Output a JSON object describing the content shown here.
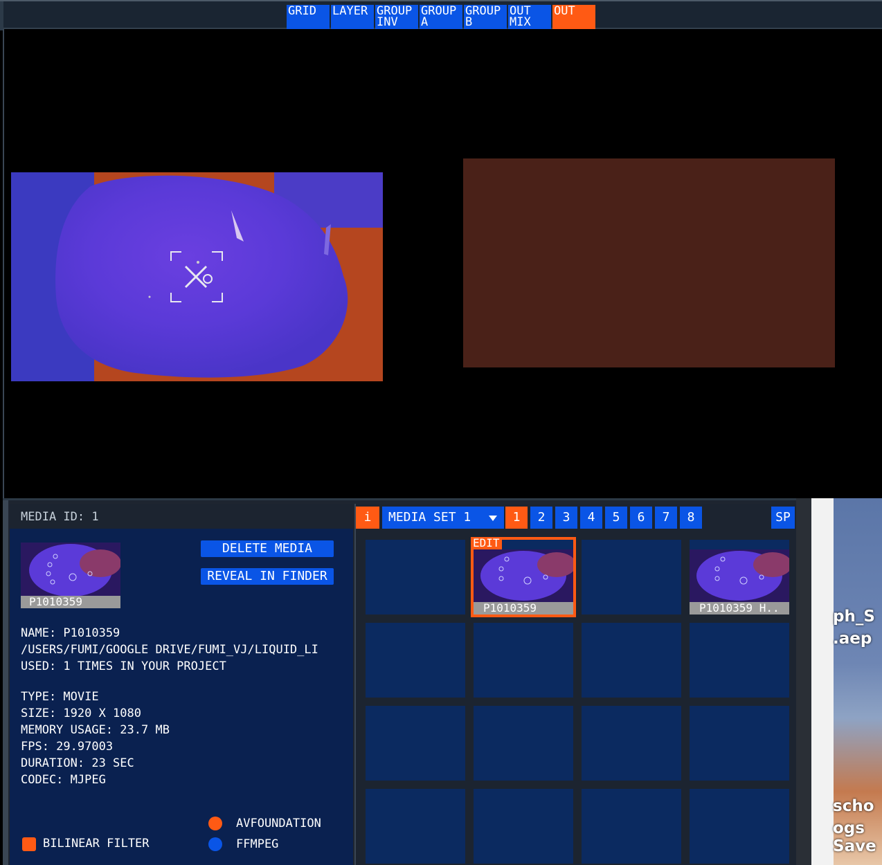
{
  "tabs": [
    {
      "label": "GRID"
    },
    {
      "label": "LAYER"
    },
    {
      "label": "GROUP\nINV"
    },
    {
      "label": "GROUP\nA"
    },
    {
      "label": "GROUP\nB"
    },
    {
      "label": "OUT\nMIX"
    },
    {
      "label": "OUT",
      "active": true
    }
  ],
  "info": {
    "header": "MEDIA ID: 1",
    "thumb_label": "P1010359",
    "delete_label": "DELETE MEDIA",
    "reveal_label": "REVEAL IN FINDER",
    "name": "NAME: P1010359",
    "path": "/USERS/FUMI/GOOGLE DRIVE/FUMI_VJ/LIQUID_LI",
    "used": "USED: 1 TIMES IN YOUR PROJECT",
    "type": "TYPE: MOVIE",
    "size": "SIZE: 1920 X 1080",
    "memory": "MEMORY USAGE: 23.7 MB",
    "fps": "FPS: 29.97003",
    "duration": "DURATION: 23 SEC",
    "codec": "CODEC: MJPEG",
    "opt_avfoundation": "AVFOUNDATION",
    "opt_ffmpeg": "FFMPEG",
    "opt_bilinear": "BILINEAR FILTER"
  },
  "gridbar": {
    "info_btn": "i",
    "media_set": "MEDIA SET 1",
    "dropdown_icon": "chevron-down-icon",
    "pages": [
      "1",
      "2",
      "3",
      "4",
      "5",
      "6",
      "7",
      "8"
    ],
    "active_page": "1",
    "sp": "SP"
  },
  "grid": {
    "edit_tag": "EDIT",
    "cell_1_label": "P1010359",
    "cell_3_label": "P1010359 H.."
  },
  "desktop": {
    "t1": "ph_S",
    "t2": ".aep",
    "t3": "scho",
    "t4": "ogs",
    "t5": "Save"
  },
  "colors": {
    "accent_blue": "#0a55e6",
    "accent_orange": "#ff5a14",
    "panel_bg": "#0a2150",
    "cell_bg": "#0b2a60"
  }
}
